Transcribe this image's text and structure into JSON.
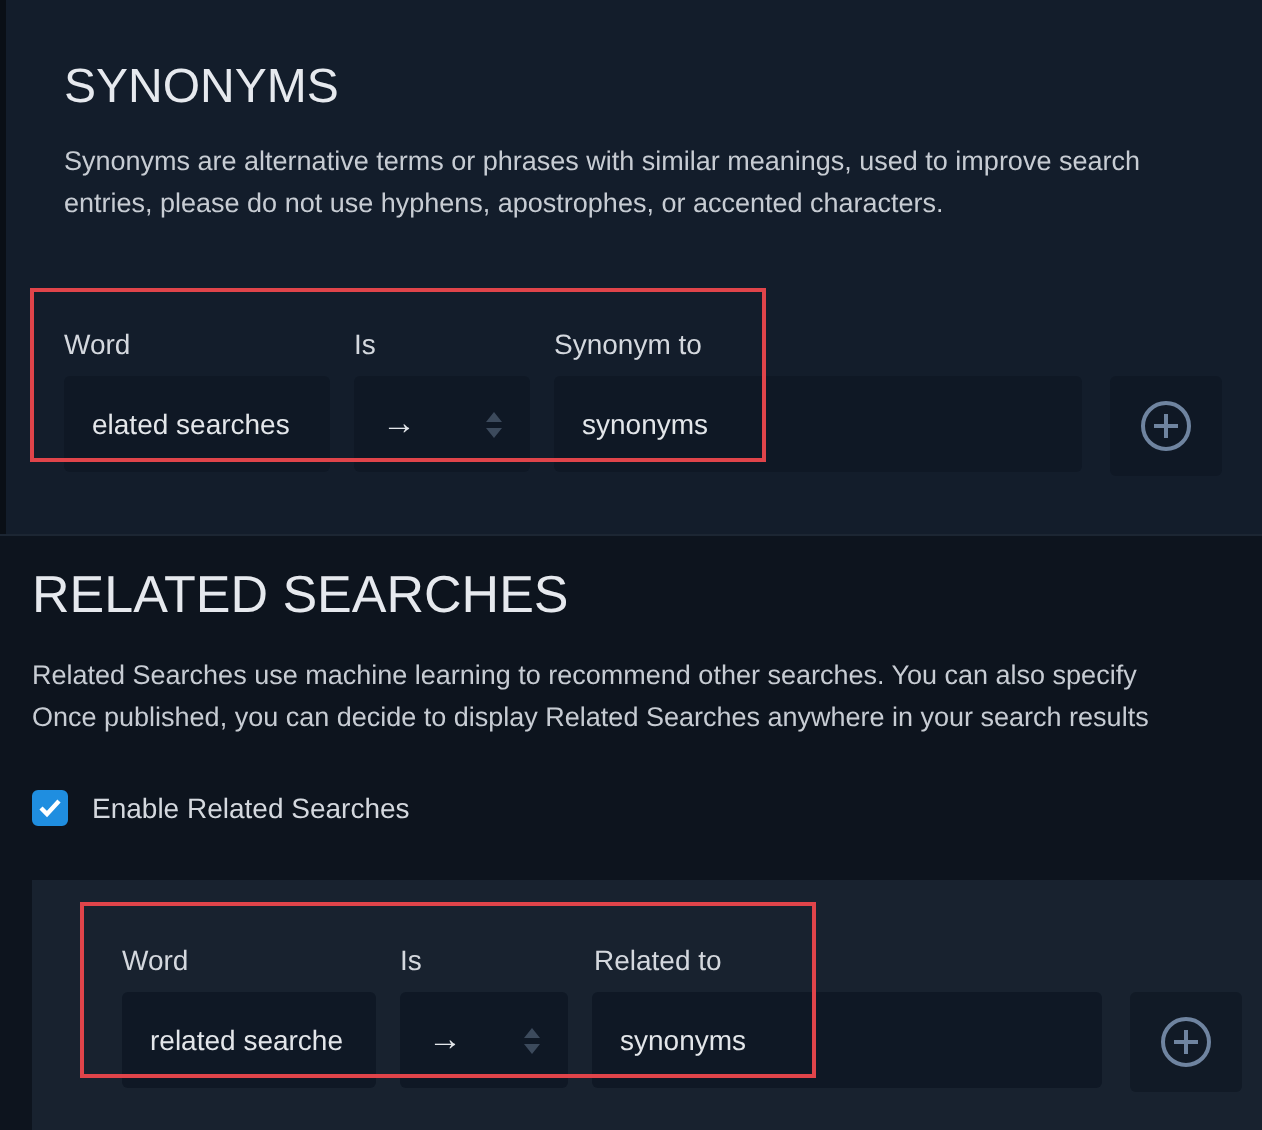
{
  "synonyms": {
    "title": "SYNONYMS",
    "description": [
      "Synonyms are alternative terms or phrases with similar meanings, used to improve search",
      "entries, please do not use hyphens, apostrophes, or accented characters."
    ],
    "row": {
      "highlighted": true,
      "labels": [
        "Word",
        "Is",
        "Synonym to"
      ],
      "word": "elated searches",
      "relation": "→",
      "target": "synonyms"
    }
  },
  "related_searches": {
    "title": "RELATED SEARCHES",
    "description": [
      "Related Searches use machine learning to recommend other searches. You can also specify",
      "Once published, you can decide to display Related Searches anywhere in your search results"
    ],
    "enable": {
      "label": "Enable Related Searches",
      "checked": true
    },
    "row": {
      "highlighted": true,
      "labels": [
        "Word",
        "Is",
        "Related to"
      ],
      "word": "related searche",
      "relation": "→",
      "target": "synonyms"
    }
  }
}
